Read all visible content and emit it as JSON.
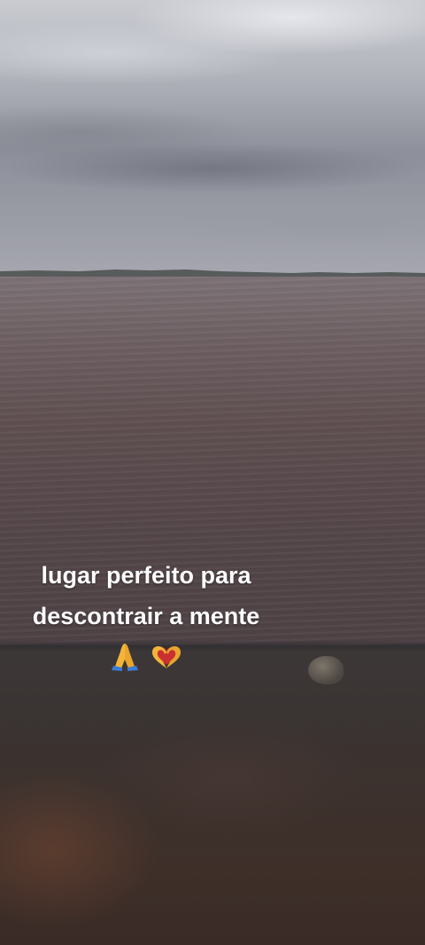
{
  "caption": {
    "line1": "lugar perfeito para",
    "line2": "descontrair a mente"
  },
  "emojis": [
    "folded-hands-icon",
    "heart-hands-icon"
  ],
  "colors": {
    "caption_text": "#ffffff",
    "water": "#5f4f51",
    "sky": "#b4b6be",
    "emoji_hands_yellow": "#f2b53a",
    "emoji_sleeve_blue": "#3a7bd5",
    "emoji_heart_red": "#d9302f"
  }
}
